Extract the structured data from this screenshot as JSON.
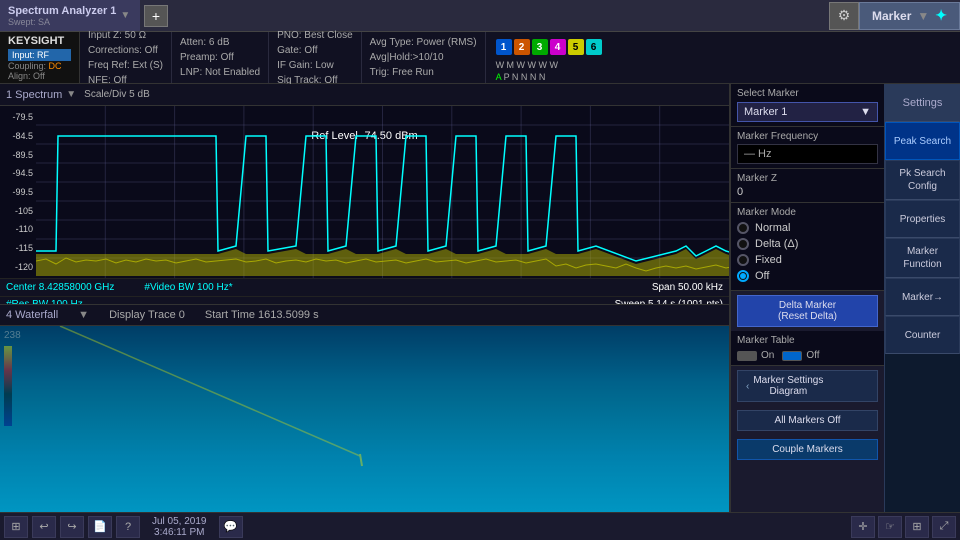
{
  "app": {
    "title": "Spectrum Analyzer 1",
    "subtitle": "Swept: SA",
    "add_btn": "+",
    "gear_icon": "⚙",
    "marker_label": "Marker",
    "sync_icon": "✦"
  },
  "info_bar": {
    "keysight": "KEYSIGHT",
    "input_label": "Input:",
    "input_value": "RF",
    "coupling_label": "Coupling:",
    "coupling_value": "DC",
    "align_label": "Align:",
    "align_value": "Off",
    "input_z": "Input Z: 50 Ω",
    "corrections": "Corrections: Off",
    "freq_ref": "Freq Ref: Ext (S)",
    "nfe": "NFE: Off",
    "atten": "Atten: 6 dB",
    "preamp": "Preamp: Off",
    "lnp": "LNP: Not Enabled",
    "pno": "PNO: Best Close",
    "gate": "Gate: Off",
    "if_gain": "IF Gain: Low",
    "sig_track": "Sig Track: Off",
    "avg_type": "Avg Type: Power (RMS)",
    "avg_hold": "Avg|Hold:>10/10",
    "trig": "Trig: Free Run",
    "marker_nums": [
      "1",
      "2",
      "3",
      "4",
      "5",
      "6"
    ],
    "wm_row": "W M W W W W",
    "ap_row": "A P N N N N"
  },
  "spectrum": {
    "title": "1 Spectrum",
    "scale": "Scale/Div 5 dB",
    "ref_level": "Ref Level -74.50 dBm",
    "y_labels": [
      "-79.5",
      "-84.5",
      "-89.5",
      "-94.5",
      "-99.5",
      "-105",
      "-110",
      "-115",
      "-120"
    ],
    "center": "Center 8.42858000 GHz",
    "video_bw": "#Video BW 100 Hz*",
    "span": "Span 50.00 kHz",
    "res_bw": "#Res BW 100 Hz",
    "sweep": "Sweep 5.14 s (1001 pts)"
  },
  "waterfall": {
    "title": "4 Waterfall",
    "display_trace": "Display Trace 0",
    "start_time": "Start Time 1613.5099 s",
    "num": "238"
  },
  "right_panel": {
    "select_marker_label": "Select Marker",
    "marker_value": "Marker 1",
    "marker_freq_label": "Marker Frequency",
    "marker_freq_value": "— Hz",
    "marker_z_label": "Marker Z",
    "marker_z_value": "0",
    "marker_mode_label": "Marker Mode",
    "mode_normal": "Normal",
    "mode_delta": "Delta (Δ)",
    "mode_fixed": "Fixed",
    "mode_off": "Off",
    "delta_btn": "Delta Marker\n(Reset Delta)",
    "marker_table_label": "Marker Table",
    "mt_on": "On",
    "mt_off": "Off",
    "marker_settings_btn": "Marker Settings\nDiagram",
    "all_markers_btn": "All Markers Off",
    "couple_markers_btn": "Couple Markers"
  },
  "sidebar_btns": {
    "settings": "Settings",
    "peak_search": "Peak Search",
    "pk_search_config": "Pk Search Config",
    "properties": "Properties",
    "marker_function": "Marker Function",
    "marker_arrow": "Marker→",
    "counter": "Counter"
  },
  "taskbar": {
    "windows_icon": "⊞",
    "back_icon": "↩",
    "forward_icon": "↪",
    "file_icon": "📄",
    "help_icon": "?",
    "datetime": "Jul 05, 2019\n3:46:11 PM",
    "chat_icon": "💬",
    "move_icon": "⊕",
    "touch_icon": "☞",
    "grid_icon": "⊞",
    "expand_icon": "⤢"
  }
}
